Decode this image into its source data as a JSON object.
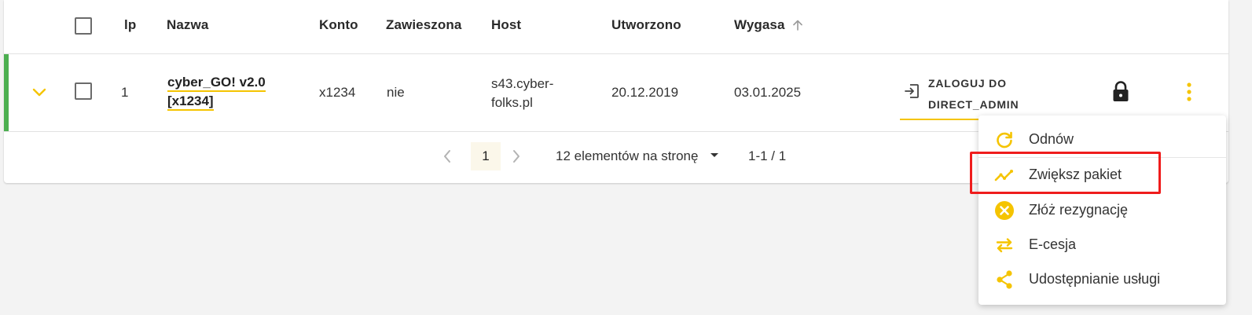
{
  "table": {
    "headers": {
      "lp": "lp",
      "name": "Nazwa",
      "account": "Konto",
      "suspended": "Zawieszona",
      "host": "Host",
      "created": "Utworzono",
      "expires": "Wygasa"
    },
    "sort": {
      "column": "expires",
      "direction": "ascending"
    },
    "rows": [
      {
        "lp": "1",
        "name_line1": "cyber_GO! v2.0",
        "name_line2": "[x1234]",
        "account": "x1234",
        "suspended": "nie",
        "host_line1": "s43.cyber-",
        "host_line2": "folks.pl",
        "created": "20.12.2019",
        "expires": "03.01.2025",
        "login_label": "ZALOGUJ DO\nDIRECT_ADMIN",
        "status_color": "#4caf50",
        "expanded": true
      }
    ]
  },
  "pagination": {
    "current_page": "1",
    "page_size_label": "12 elementów na stronę",
    "range_label": "1-1 / 1"
  },
  "context_menu": {
    "items": [
      {
        "label": "Odnów",
        "icon": "refresh-icon"
      },
      {
        "label": "Zwiększ pakiet",
        "icon": "trending-up-icon",
        "highlighted": true
      },
      {
        "label": "Złóż rezygnację",
        "icon": "cancel-circle-icon"
      },
      {
        "label": "E-cesja",
        "icon": "swap-arrows-icon"
      },
      {
        "label": "Udostępnianie usługi",
        "icon": "share-icon"
      }
    ]
  },
  "colors": {
    "accent": "#f5c400",
    "status_active": "#4caf50",
    "highlight_box": "#ef1c1c",
    "background": "#f3f3f3"
  }
}
